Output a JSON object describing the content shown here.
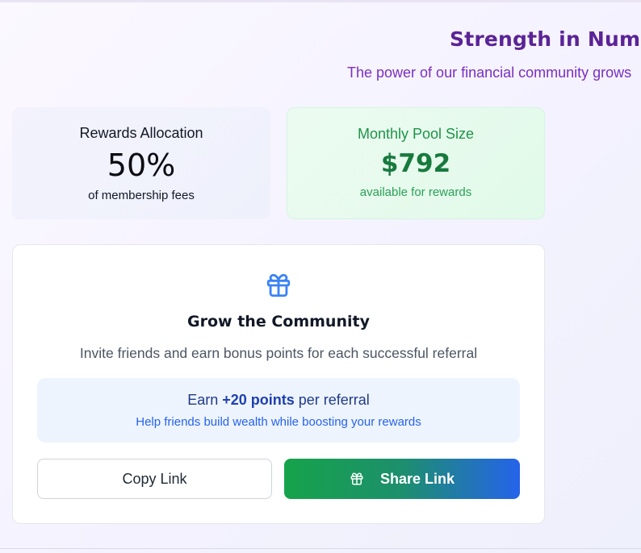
{
  "header": {
    "title": "Strength in Numbe",
    "subtitle": "The power of our financial community grows"
  },
  "stats": {
    "rewards_allocation": {
      "label": "Rewards Allocation",
      "value": "50%",
      "caption": "of membership fees"
    },
    "monthly_pool": {
      "label": "Monthly Pool Size",
      "value": "$792",
      "caption": "available for rewards"
    }
  },
  "community": {
    "icon": "gift-icon",
    "title": "Grow the Community",
    "description": "Invite friends and earn bonus points for each successful referral",
    "earn": {
      "prefix": "Earn ",
      "points": "+20 points",
      "suffix": " per referral",
      "subtext": "Help friends build wealth while boosting your rewards"
    },
    "buttons": {
      "copy_label": "Copy Link",
      "share_label": "Share Link",
      "share_icon": "gift-icon"
    }
  },
  "colors": {
    "headline": "#5b2396",
    "subheadline": "#7a2fc0",
    "pool_green": "#177a3d",
    "accent_blue": "#2563eb",
    "share_gradient_start": "#16a34a",
    "share_gradient_end": "#2563eb"
  }
}
